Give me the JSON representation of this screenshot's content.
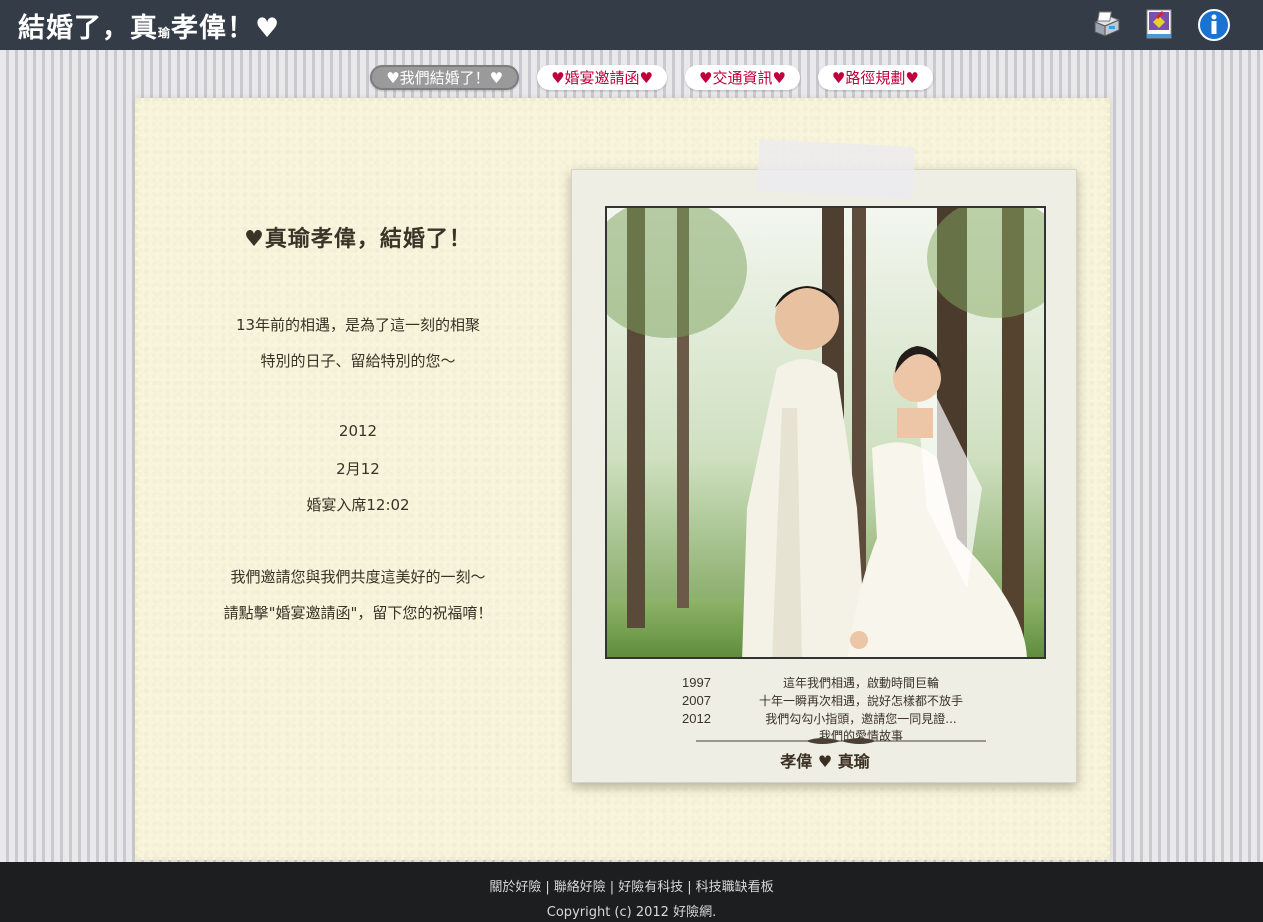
{
  "header": {
    "title_part1": "結婚了，真",
    "title_small": "瑜",
    "title_part2": "孝偉！♥",
    "icons": [
      "printer-icon",
      "edit-note-icon",
      "info-icon"
    ]
  },
  "tabs": [
    {
      "label": "♥我們結婚了！♥",
      "active": true
    },
    {
      "label": "♥婚宴邀請函♥",
      "active": false
    },
    {
      "label": "♥交通資訊♥",
      "active": false
    },
    {
      "label": "♥路徑規劃♥",
      "active": false
    }
  ],
  "invite": {
    "title": "♥真瑜孝偉，結婚了！",
    "line1": "13年前的相遇，是為了這一刻的相聚",
    "line2": "特別的日子、留給特別的您～",
    "year": "2012",
    "date": "2月12",
    "time": "婚宴入席12:02",
    "line3": "我們邀請您與我們共度這美好的一刻～",
    "line4": "請點擊\"婚宴邀請函\"，留下您的祝福唷！"
  },
  "photo_card": {
    "captions": [
      {
        "year": "1997",
        "text": "這年我們相遇，啟動時間巨輪"
      },
      {
        "year": "2007",
        "text": "十年一瞬再次相遇，說好怎樣都不放手"
      },
      {
        "year": "2012",
        "text": "我們勾勾小指頭，邀請您一同見證..."
      }
    ],
    "caption_extra": "我們的愛情故事",
    "signature": "孝偉 ♥ 真瑜"
  },
  "footer": {
    "links": [
      "關於好險",
      "聯絡好險",
      "好險有科技",
      "科技職缺看板"
    ],
    "separator": "|",
    "copyright": "Copyright (c) 2012 好險網."
  },
  "colors": {
    "topbar": "#343c48",
    "tab_text": "#c0003c",
    "paper": "#f8f5dd",
    "footer": "#1d1e20"
  }
}
